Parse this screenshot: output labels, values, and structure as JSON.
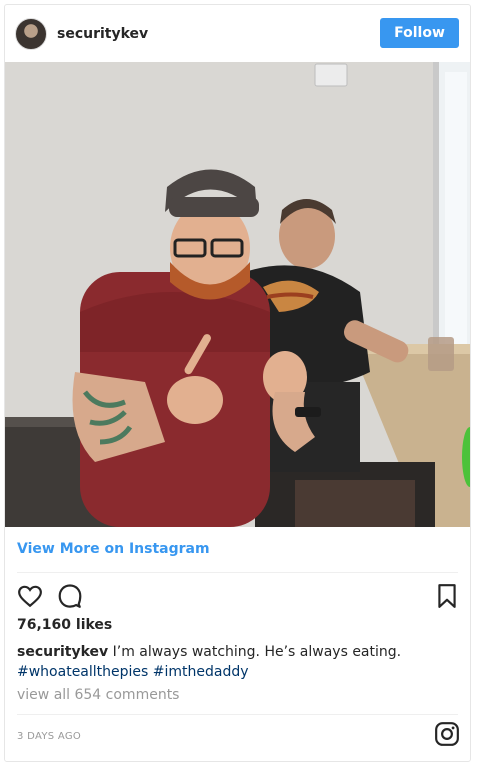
{
  "post": {
    "username": "securitykev",
    "follow_label": "Follow",
    "view_more_label": "View More on Instagram",
    "likes": "76,160 likes",
    "caption_user": "securitykev",
    "caption_text": "I’m always watching. He’s always eating.",
    "hashtags": [
      "#whoateallthepies",
      "#imthedaddy"
    ],
    "comments_link": "view all 654 comments",
    "timestamp": "3 DAYS AGO"
  },
  "icons": {
    "like": "heart-icon",
    "comment": "comment-icon",
    "save": "bookmark-icon",
    "logo": "instagram-icon"
  },
  "colors": {
    "follow_button": "#3897f0",
    "link": "#3897f0",
    "hashtag": "#003569",
    "muted": "#999999"
  }
}
